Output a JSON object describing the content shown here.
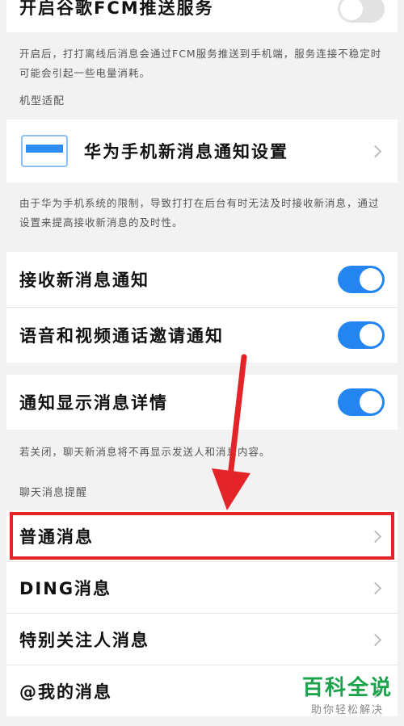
{
  "fcm": {
    "label": "开启谷歌FCM推送服务",
    "enabled": false,
    "note": "开启后，打打离线后消息会通过FCM服务推送到手机端，服务连接不稳定时可能会引起一些电量消耗。"
  },
  "device_section": {
    "title": "机型适配",
    "huawei_label": "华为手机新消息通知设置",
    "note": "由于华为手机系统的限制，导致打打在后台有时无法及时接收新消息，通过设置来提高接收新消息的及时性。"
  },
  "notifications": {
    "receive_label": "接收新消息通知",
    "receive_enabled": true,
    "call_label": "语音和视频通话邀请通知",
    "call_enabled": true,
    "detail_label": "通知显示消息详情",
    "detail_enabled": true,
    "detail_note": "若关闭，聊天新消息将不再显示发送人和消息内容。"
  },
  "reminder_section": {
    "title": "聊天消息提醒",
    "items": [
      {
        "label": "普通消息"
      },
      {
        "label": "DING消息"
      },
      {
        "label": "特别关注人消息"
      },
      {
        "label": "@我的消息"
      }
    ]
  },
  "watermark": {
    "title": "百科全说",
    "subtitle": "助你轻松解决"
  },
  "colors": {
    "accent": "#2484f0",
    "highlight": "#e3252a",
    "watermark": "#1aa34a"
  }
}
